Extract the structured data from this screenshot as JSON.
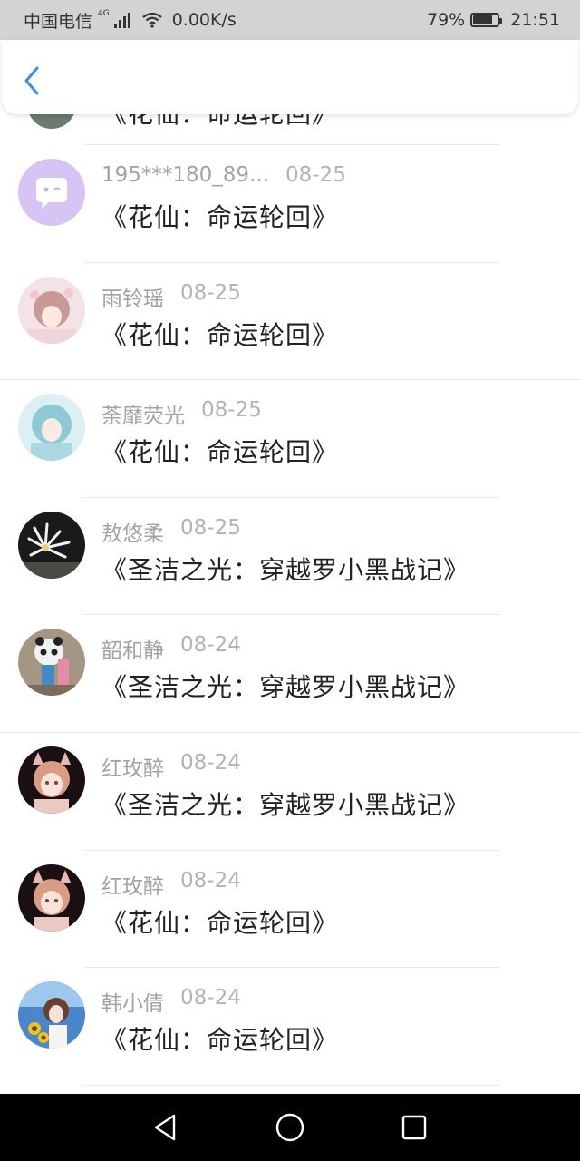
{
  "status_bar": {
    "carrier": "中国电信",
    "network_type": "4G",
    "speed": "0.00K/s",
    "battery": "79%",
    "battery_level": 0.79,
    "time": "21:51"
  },
  "header": {
    "back_icon": "chevron-left-icon",
    "accent_color": "#3a8ee6"
  },
  "list": {
    "partial_top_title": "《花仙：命运轮回》",
    "items": [
      {
        "name": "195***180_89...",
        "date": "08-25",
        "title": "《花仙：命运轮回》",
        "avatar": "default-chat-avatar"
      },
      {
        "name": "雨铃瑶",
        "date": "08-25",
        "title": "《花仙：命运轮回》",
        "avatar": "anime-girl-pink-avatar"
      },
      {
        "name": "荼靡荧光",
        "date": "08-25",
        "title": "《花仙：命运轮回》",
        "avatar": "anime-girl-blue-avatar"
      },
      {
        "name": "敖悠柔",
        "date": "08-25",
        "title": "《圣洁之光：穿越罗小黑战记》",
        "avatar": "white-flower-avatar"
      },
      {
        "name": "韶和静",
        "date": "08-24",
        "title": "《圣洁之光：穿越罗小黑战记》",
        "avatar": "panda-photo-avatar"
      },
      {
        "name": "红玫醉",
        "date": "08-24",
        "title": "《圣洁之光：穿越罗小黑战记》",
        "avatar": "anime-catgirl-avatar"
      },
      {
        "name": "红玫醉",
        "date": "08-24",
        "title": "《花仙：命运轮回》",
        "avatar": "anime-catgirl-avatar"
      },
      {
        "name": "韩小倩",
        "date": "08-24",
        "title": "《花仙：命运轮回》",
        "avatar": "sunflower-girl-avatar"
      }
    ]
  },
  "nav_bar": {
    "back": "triangle-back-icon",
    "home": "circle-home-icon",
    "recents": "square-recents-icon"
  }
}
